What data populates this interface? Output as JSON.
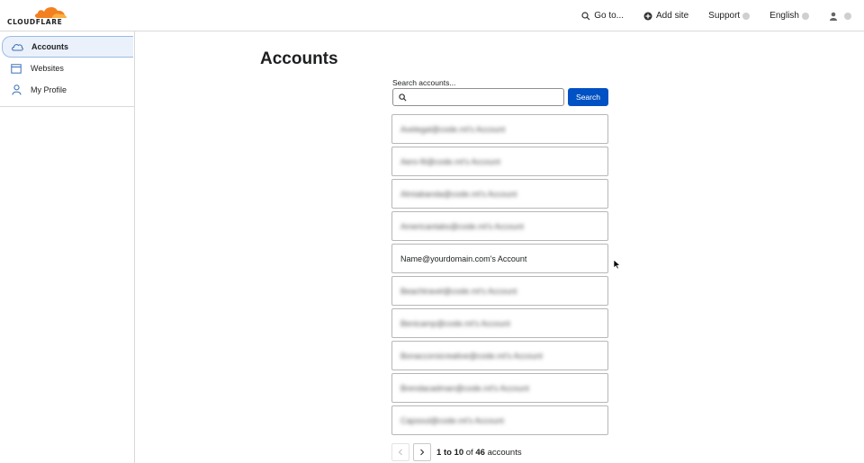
{
  "brand": {
    "wordmark": "CLOUDFLARE",
    "accent": "#f38020"
  },
  "topnav": {
    "goto_label": "Go to...",
    "add_site_label": "Add site",
    "support_label": "Support",
    "language_label": "English"
  },
  "sidebar": {
    "items": [
      {
        "label": "Accounts",
        "icon": "cloud-icon",
        "active": true
      },
      {
        "label": "Websites",
        "icon": "browser-window-icon",
        "active": false
      },
      {
        "label": "My Profile",
        "icon": "person-icon",
        "active": false
      }
    ]
  },
  "main": {
    "title": "Accounts",
    "search": {
      "label": "Search accounts...",
      "value": "",
      "button_label": "Search"
    },
    "accounts": [
      {
        "name": "Avelegal@code.mt's Account",
        "blurred": true
      },
      {
        "name": "Aero-fit@code.mt's Account",
        "blurred": true
      },
      {
        "name": "Almiabanda@code.mt's Account",
        "blurred": true
      },
      {
        "name": "Americantabs@code.mt's Account",
        "blurred": true
      },
      {
        "name": "Name@yourdomain.com's Account",
        "blurred": false
      },
      {
        "name": "Beachtravel@code.mt's Account",
        "blurred": true
      },
      {
        "name": "Benicamp@code.mt's Account",
        "blurred": true
      },
      {
        "name": "Bonaccorsicreative@code.mt's Account",
        "blurred": true
      },
      {
        "name": "Brendacadman@code.mt's Account",
        "blurred": true
      },
      {
        "name": "Capsoul@code.mt's Account",
        "blurred": true
      }
    ],
    "pagination": {
      "from": "1",
      "to_word": "to",
      "to": "10",
      "of_word": "of",
      "total": "46",
      "unit": "accounts"
    }
  },
  "colors": {
    "primary_button": "#0051c3",
    "active_nav_bg": "#eaf1fb",
    "active_nav_border": "#9bbbe6"
  }
}
